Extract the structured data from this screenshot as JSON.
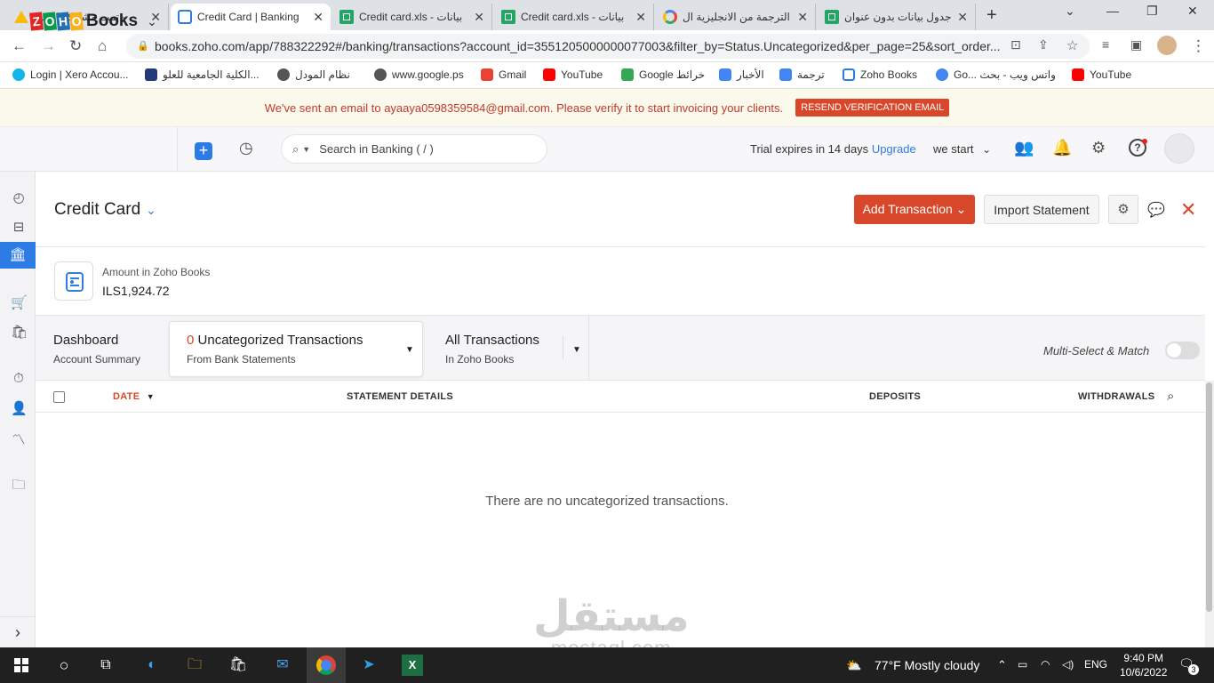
{
  "browser": {
    "tabs": [
      {
        "title": "تمت مشاركتها معي - ",
        "favicon": "drive-icon",
        "active": false
      },
      {
        "title": "Credit Card | Banking",
        "favicon": "zoho-books-icon",
        "active": true
      },
      {
        "title": "Credit card.xls - بيانات",
        "favicon": "sheets-icon",
        "active": false
      },
      {
        "title": "Credit card.xls - بيانات",
        "favicon": "sheets-icon",
        "active": false
      },
      {
        "title": "الترجمة من الانجليزية ال",
        "favicon": "google-icon",
        "active": false
      },
      {
        "title": "جدول بيانات بدون عنوان",
        "favicon": "sheets-icon",
        "active": false
      }
    ],
    "url": "books.zoho.com/app/788322292#/banking/transactions?account_id=3551205000000077003&filter_by=Status.Uncategorized&per_page=25&sort_order...",
    "bookmarks": [
      {
        "label": "Login | Xero Accou...",
        "color": "#13b5ea"
      },
      {
        "label": "الكلية الجامعية للعلو...",
        "color": "#223a7a"
      },
      {
        "label": "نظام المودل",
        "color": "#444"
      },
      {
        "label": "www.google.ps",
        "color": "#444"
      },
      {
        "label": "Gmail",
        "color": "#ea4335"
      },
      {
        "label": "YouTube",
        "color": "#ff0000"
      },
      {
        "label": "Google خرائط",
        "color": "#34a853"
      },
      {
        "label": "الأخبار",
        "color": "#4285f4"
      },
      {
        "label": "ترجمة",
        "color": "#4285f4"
      },
      {
        "label": "Zoho Books",
        "color": "#2d7be5"
      },
      {
        "label": "Go... واتس ويب - بحث",
        "color": "#4285f4"
      },
      {
        "label": "YouTube",
        "color": "#ff0000"
      }
    ]
  },
  "banner": {
    "message": "We've sent an email to ayaaya0598359584@gmail.com. Please verify it to start invoicing your clients.",
    "button": "RESEND VERIFICATION EMAIL"
  },
  "header": {
    "logo_text": "Books",
    "logo_letters": [
      "Z",
      "O",
      "H",
      "O"
    ],
    "logo_colors": [
      "#e42527",
      "#089949",
      "#226db4",
      "#f9b21d"
    ],
    "search_placeholder": "Search in Banking ( / )",
    "trial_text": "Trial expires in 14 days",
    "upgrade": "Upgrade",
    "org": "we start"
  },
  "page": {
    "title": "Credit Card",
    "add_transaction": "Add Transaction",
    "import_statement": "Import Statement",
    "amount_label": "Amount in Zoho Books",
    "amount_value": "ILS1,924.72"
  },
  "tabs": {
    "dashboard": {
      "title": "Dashboard",
      "sub": "Account Summary"
    },
    "uncategorized": {
      "count": "0",
      "title": "Uncategorized Transactions",
      "sub": "From Bank Statements"
    },
    "all": {
      "title": "All Transactions",
      "sub": "In Zoho Books"
    },
    "multi_select": "Multi-Select & Match"
  },
  "table": {
    "columns": {
      "date": "DATE",
      "details": "STATEMENT DETAILS",
      "deposits": "DEPOSITS",
      "withdrawals": "WITHDRAWALS"
    },
    "empty_message": "There are no uncategorized transactions."
  },
  "watermark": {
    "arabic": "مستقل",
    "latin": "mostaql.com"
  },
  "taskbar": {
    "weather": "77°F  Mostly cloudy",
    "lang": "ENG",
    "time": "9:40 PM",
    "date": "10/6/2022",
    "notifications": "3"
  }
}
